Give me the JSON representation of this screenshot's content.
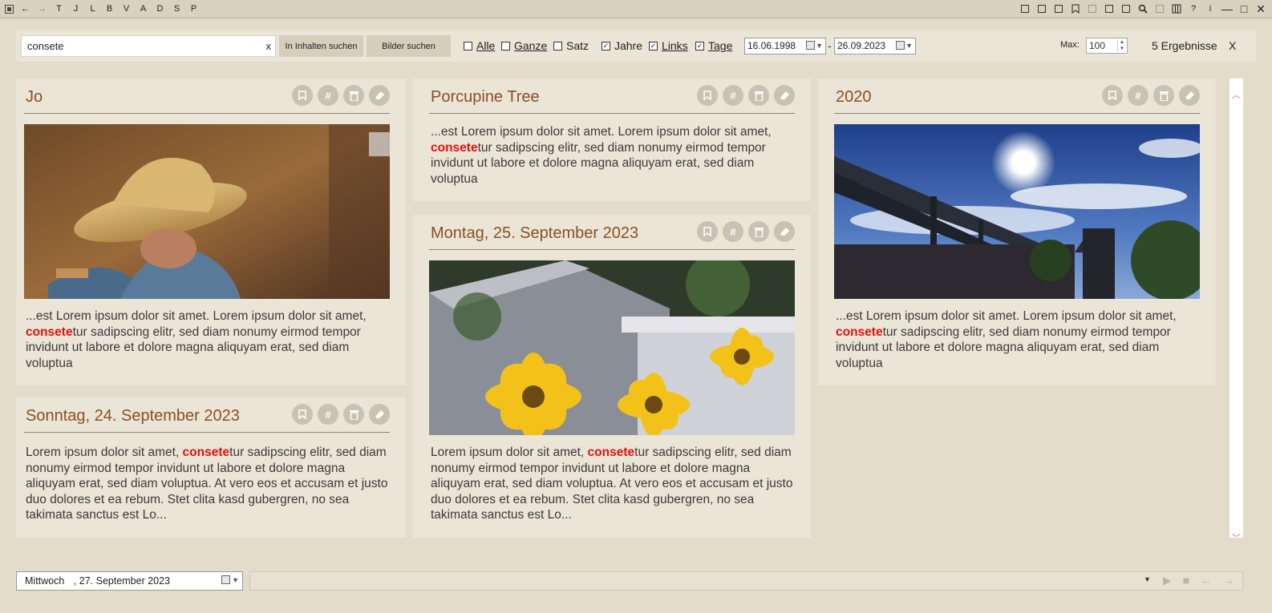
{
  "titlebar": {
    "nav": [
      "←",
      "→"
    ],
    "letters": [
      "T",
      "J",
      "L",
      "B",
      "V",
      "A",
      "D",
      "S",
      "P"
    ],
    "help": "?",
    "info": "i",
    "window": {
      "minimize": "—",
      "maximize": "□",
      "close": "✕"
    }
  },
  "search": {
    "value": "consete",
    "clear": "x",
    "btn_content": "In Inhalten suchen",
    "btn_images": "Bilder suchen"
  },
  "filters": [
    {
      "label": "Alle",
      "checked": false
    },
    {
      "label": "Ganze",
      "checked": false
    },
    {
      "label": "Satz",
      "checked": false
    },
    {
      "label": "Jahre",
      "checked": true
    },
    {
      "label": "Links",
      "checked": true
    },
    {
      "label": "Tage",
      "checked": true
    }
  ],
  "date_from": "16.06.1998",
  "date_to": "26.09.2023",
  "date_sep": "-",
  "max_label": "Max:",
  "max_value": "100",
  "results": "5 Ergebnisse",
  "close": "X",
  "highlight": "consete",
  "cards": [
    {
      "title": "Jo",
      "pre": "...est Lorem ipsum dolor sit amet. Lorem ipsum dolor sit amet, ",
      "post": "tur sadipscing elitr, sed diam nonumy eirmod tempor invidunt ut labore et dolore magna aliquyam erat, sed diam voluptua"
    },
    {
      "title": "Sonntag, 24. September 2023",
      "pre": "Lorem ipsum dolor sit amet, ",
      "post": "tur sadipscing elitr, sed diam nonumy eirmod tempor invidunt ut labore et dolore magna aliquyam erat, sed diam voluptua. At vero eos et accusam et justo duo dolores et ea rebum. Stet clita kasd gubergren, no sea takimata sanctus est Lo..."
    },
    {
      "title": "Porcupine Tree",
      "pre": "...est Lorem ipsum dolor sit amet. Lorem ipsum dolor sit amet, ",
      "post": "tur sadipscing elitr, sed diam nonumy eirmod tempor invidunt ut labore et dolore magna aliquyam erat, sed diam voluptua"
    },
    {
      "title": "Montag, 25. September 2023",
      "pre": "Lorem ipsum dolor sit amet, ",
      "post": "tur sadipscing elitr, sed diam nonumy eirmod tempor invidunt ut labore et dolore magna aliquyam erat, sed diam voluptua. At vero eos et accusam et justo duo dolores et ea rebum. Stet clita kasd gubergren, no sea takimata sanctus est Lo..."
    },
    {
      "title": "2020",
      "pre": "...est Lorem ipsum dolor sit amet. Lorem ipsum dolor sit amet, ",
      "post": "tur sadipscing elitr, sed diam nonumy eirmod tempor invidunt ut labore et dolore magna aliquyam erat, sed diam voluptua"
    }
  ],
  "card_actions": {
    "tag": "#"
  },
  "bottom": {
    "weekday": "Mittwoch",
    "date": ", 27. September 2023"
  },
  "colors": {
    "title": "#8a4f22",
    "highlight": "#e01010",
    "panel": "#ebe5d7",
    "background": "#e3dcca"
  },
  "icons": [
    "bookmark-icon",
    "hashtag-icon",
    "trash-icon",
    "eraser-icon",
    "calendar-icon",
    "search-icon",
    "play-icon",
    "stop-icon",
    "arrow-left-icon",
    "arrow-right-icon"
  ]
}
